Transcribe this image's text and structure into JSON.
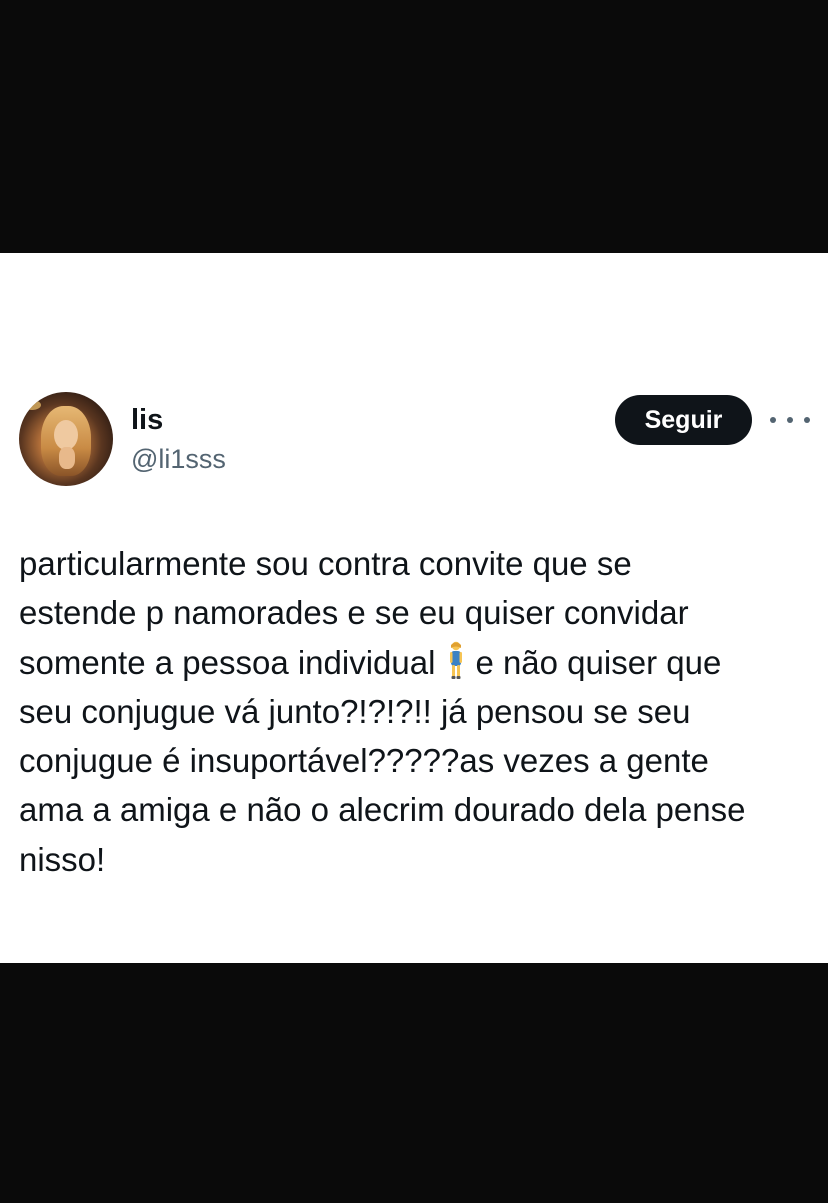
{
  "user": {
    "display_name": "lis",
    "handle": "@li1sss"
  },
  "actions": {
    "follow_label": "Seguir"
  },
  "tweet": {
    "text_before_emoji": "particularmente sou contra convite que se\nestende p namorades e se eu quiser convidar\nsomente a pessoa individual",
    "emoji": "standing-person-icon",
    "text_after_emoji": "e não quiser que\nseu conjugue vá junto?!?!?!! já pensou se seu\nconjugue é insuportável?????as vezes a gente\nama a amiga e não o alecrim dourado dela pense\nnisso!"
  },
  "colors": {
    "background_dark": "#0a0a0a",
    "card": "#ffffff",
    "text_primary": "#0f1419",
    "text_secondary": "#536471",
    "button_bg": "#0f1419",
    "button_text": "#ffffff"
  }
}
